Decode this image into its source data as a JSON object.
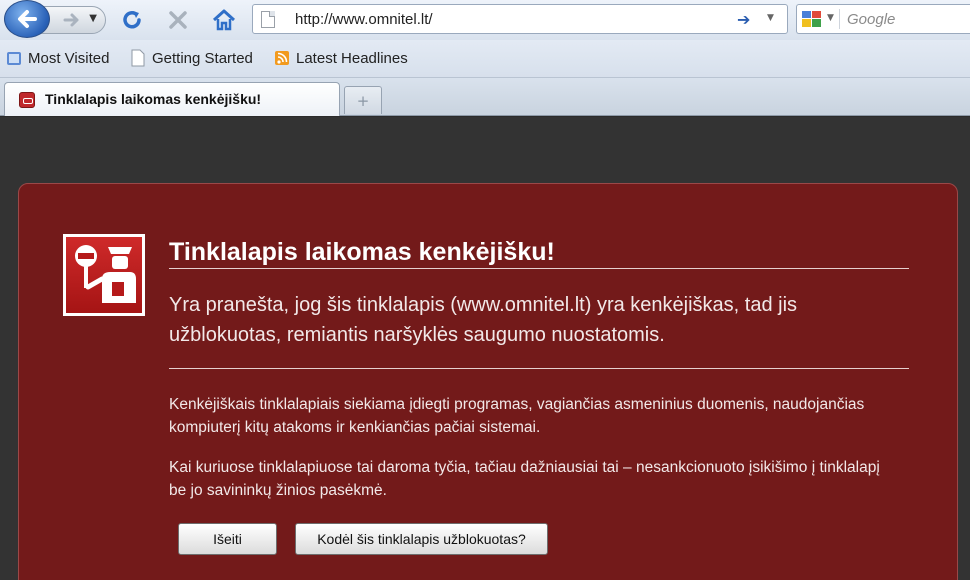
{
  "toolbar": {
    "back_icon": "back-arrow-icon",
    "forward_icon": "forward-arrow-icon",
    "reload_icon": "reload-icon",
    "stop_icon": "stop-icon",
    "home_icon": "home-icon",
    "url": "http://www.omnitel.lt/",
    "go_icon": "go-arrow-icon",
    "search_placeholder": "Google"
  },
  "bookmarks": [
    {
      "label": "Most Visited",
      "icon": "bookmark-folder-icon"
    },
    {
      "label": "Getting Started",
      "icon": "page-icon"
    },
    {
      "label": "Latest Headlines",
      "icon": "rss-icon"
    }
  ],
  "tabs": [
    {
      "label": "Tinklalapis laikomas kenkėjišku!",
      "icon": "blocked-site-favicon"
    }
  ],
  "new_tab_label": "+",
  "warning": {
    "title": "Tinklalapis laikomas kenkėjišku!",
    "lead": "Yra pranešta, jog šis tinklalapis (www.omnitel.lt) yra kenkėjiškas, tad jis užblokuotas, remiantis naršyklės saugumo nuostatomis.",
    "paragraph1": "Kenkėjiškais tinklalapiais siekiama įdiegti programas, vagiančias asmeninius duomenis, naudojančias kompiuterį kitų atakoms ir kenkiančias pačiai sistemai.",
    "paragraph2": "Kai kuriuose tinklalapiuose tai daroma tyčia, tačiau dažniausiai tai – nesankcionuoto įsikišimo į tinklalapį be jo savininkų žinios pasėkmė.",
    "exit_button": "Išeiti",
    "why_button": "Kodėl šis tinklalapis užblokuotas?"
  },
  "colors": {
    "panel_bg": "#731a1a",
    "page_bg": "#333333",
    "icon_red": "#c0282b"
  }
}
